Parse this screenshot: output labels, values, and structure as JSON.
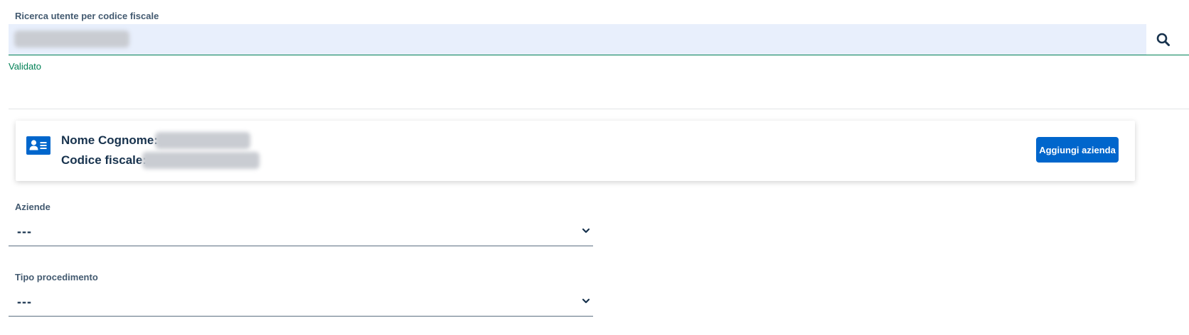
{
  "search": {
    "label": "Ricerca utente per codice fiscale",
    "status": "Validato",
    "icon": "search-icon",
    "value_hidden": true
  },
  "user_card": {
    "icon": "id-card-icon",
    "name_label": "Nome Cognome:",
    "fiscal_code_label": "Codice fiscale:",
    "add_button_label": "Aggiungi azienda"
  },
  "companies": {
    "label": "Aziende",
    "selected": "---"
  },
  "procedure_type": {
    "label": "Tipo procedimento",
    "selected": "---"
  },
  "colors": {
    "accent": "#0066cc",
    "success": "#008055",
    "input_background": "#e8effc",
    "text": "#17324d",
    "label": "#435a70"
  }
}
